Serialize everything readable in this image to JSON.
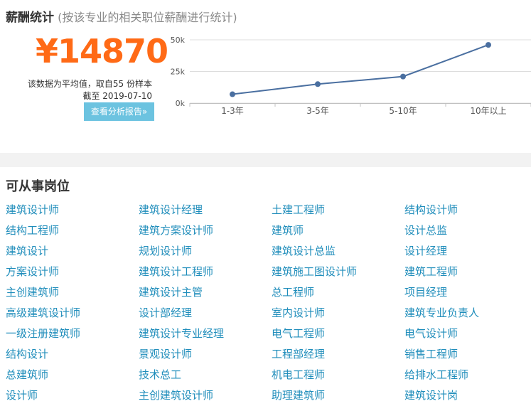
{
  "salary": {
    "title": "薪酬统计",
    "subtitle": "(按该专业的相关职位薪酬进行统计)",
    "amount": "¥14870",
    "note_line1": "该数据为平均值，取自55 份样本",
    "note_line2": "截至 2019-07-10",
    "report_button": "查看分析报告»"
  },
  "chart_data": {
    "type": "line",
    "categories": [
      "1-3年",
      "3-5年",
      "5-10年",
      "10年以上"
    ],
    "values": [
      7000,
      15000,
      21000,
      46000
    ],
    "ylim": [
      0,
      50000
    ],
    "yticks": [
      {
        "value": 0,
        "label": "0k"
      },
      {
        "value": 25000,
        "label": "25k"
      },
      {
        "value": 50000,
        "label": "50k"
      }
    ],
    "grid": true,
    "color": "#4a6fa0"
  },
  "positions": {
    "title": "可从事岗位",
    "items": [
      "建筑设计师",
      "建筑设计经理",
      "土建工程师",
      "结构设计师",
      "结构工程师",
      "建筑方案设计师",
      "建筑师",
      "设计总监",
      "建筑设计",
      "规划设计师",
      "建筑设计总监",
      "设计经理",
      "方案设计师",
      "建筑设计工程师",
      "建筑施工图设计师",
      "建筑工程师",
      "主创建筑师",
      "建筑设计主管",
      "总工程师",
      "项目经理",
      "高级建筑设计师",
      "设计部经理",
      "室内设计师",
      "建筑专业负责人",
      "一级注册建筑师",
      "建筑设计专业经理",
      "电气工程师",
      "电气设计师",
      "结构设计",
      "景观设计师",
      "工程部经理",
      "销售工程师",
      "总建筑师",
      "技术总工",
      "机电工程师",
      "给排水工程师",
      "设计师",
      "主创建筑设计师",
      "助理建筑师",
      "建筑设计岗"
    ]
  }
}
